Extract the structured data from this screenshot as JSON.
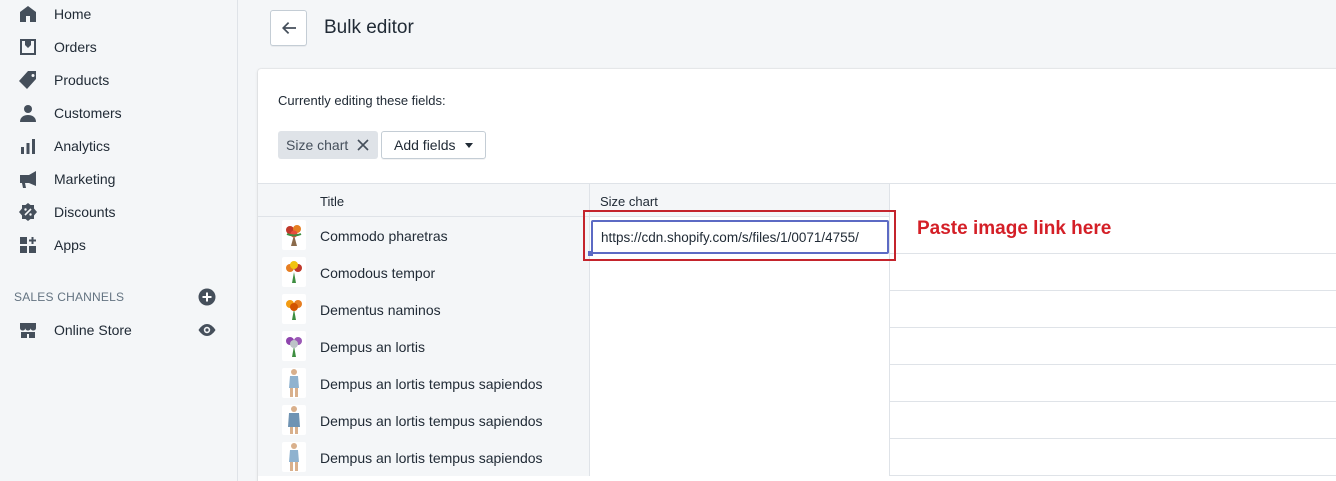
{
  "sidebar": {
    "items": [
      {
        "label": "Home",
        "icon": "home-icon"
      },
      {
        "label": "Orders",
        "icon": "orders-icon"
      },
      {
        "label": "Products",
        "icon": "tag-icon"
      },
      {
        "label": "Customers",
        "icon": "person-icon"
      },
      {
        "label": "Analytics",
        "icon": "bar-chart-icon"
      },
      {
        "label": "Marketing",
        "icon": "megaphone-icon"
      },
      {
        "label": "Discounts",
        "icon": "discount-icon"
      },
      {
        "label": "Apps",
        "icon": "apps-icon"
      }
    ],
    "sales_channels_title": "SALES CHANNELS",
    "channels": [
      {
        "label": "Online Store",
        "icon": "store-icon"
      }
    ]
  },
  "header": {
    "title": "Bulk editor"
  },
  "editor": {
    "editing_label": "Currently editing these fields:",
    "field_tag": "Size chart",
    "add_fields_label": "Add fields",
    "columns": {
      "title": "Title",
      "size_chart": "Size chart"
    },
    "rows": [
      {
        "title": "Commodo pharetras",
        "size_chart": "https://cdn.shopify.com/s/files/1/0071/4755/"
      },
      {
        "title": "Comodous tempor",
        "size_chart": ""
      },
      {
        "title": "Dementus naminos",
        "size_chart": ""
      },
      {
        "title": "Dempus an lortis",
        "size_chart": ""
      },
      {
        "title": "Dempus an lortis tempus sapiendos",
        "size_chart": ""
      },
      {
        "title": "Dempus an lortis tempus sapiendos",
        "size_chart": ""
      },
      {
        "title": "Dempus an lortis tempus sapiendos",
        "size_chart": ""
      }
    ]
  },
  "annotation": {
    "text": "Paste image link here",
    "color": "#d41f27"
  },
  "colors": {
    "accent": "#5c6ac4",
    "annotation_red": "#c4242c"
  }
}
